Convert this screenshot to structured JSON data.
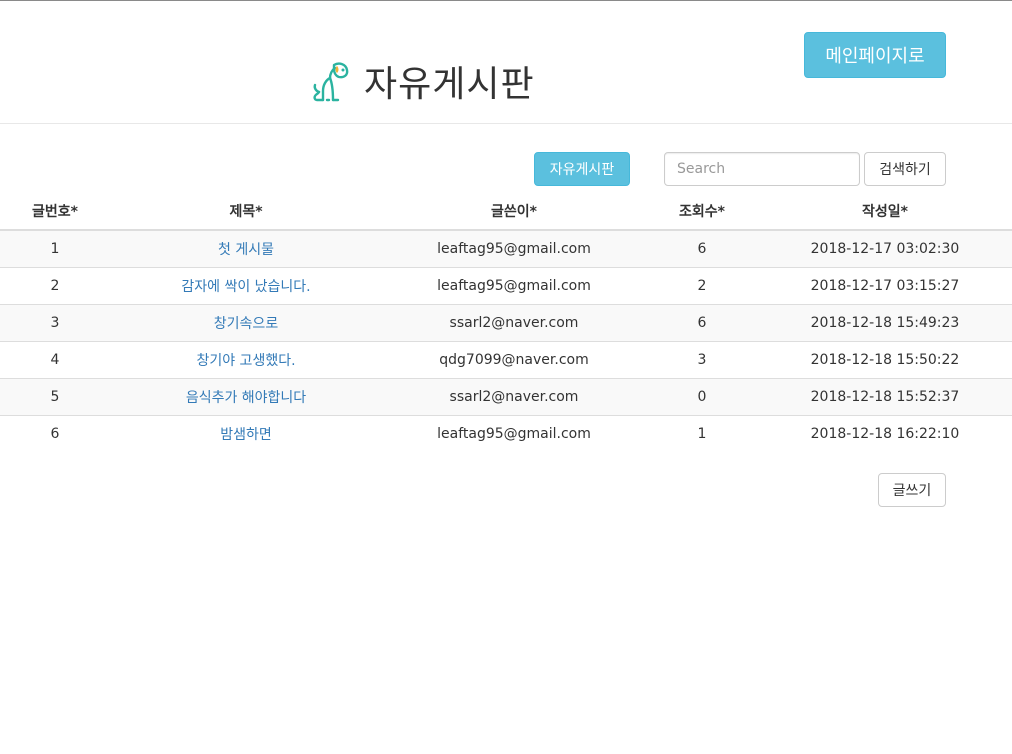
{
  "header": {
    "title": "자유게시판",
    "main_page_button": "메인페이지로",
    "logo_icon": "dog-logo-icon",
    "accent_color": "#5bc0de"
  },
  "toolbar": {
    "board_button": "자유게시판",
    "search_placeholder": "Search",
    "search_value": "",
    "search_button": "검색하기"
  },
  "table": {
    "columns": [
      "글번호*",
      "제목*",
      "글쓴이*",
      "조회수*",
      "작성일*"
    ],
    "rows": [
      {
        "no": "1",
        "title": "첫 게시물",
        "author": "leaftag95@gmail.com",
        "views": "6",
        "date": "2018-12-17 03:02:30"
      },
      {
        "no": "2",
        "title": "감자에 싹이 났습니다.",
        "author": "leaftag95@gmail.com",
        "views": "2",
        "date": "2018-12-17 03:15:27"
      },
      {
        "no": "3",
        "title": "창기속으로",
        "author": "ssarl2@naver.com",
        "views": "6",
        "date": "2018-12-18 15:49:23"
      },
      {
        "no": "4",
        "title": "창기야 고생했다.",
        "author": "qdg7099@naver.com",
        "views": "3",
        "date": "2018-12-18 15:50:22"
      },
      {
        "no": "5",
        "title": "음식추가 해야합니다",
        "author": "ssarl2@naver.com",
        "views": "0",
        "date": "2018-12-18 15:52:37"
      },
      {
        "no": "6",
        "title": "밤샘하면",
        "author": "leaftag95@gmail.com",
        "views": "1",
        "date": "2018-12-18 16:22:10"
      }
    ]
  },
  "footer": {
    "write_button": "글쓰기"
  }
}
